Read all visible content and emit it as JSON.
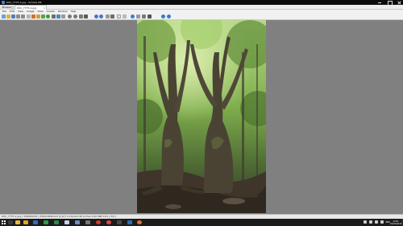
{
  "window": {
    "title": "DSC_7775-1.jpg - XnView MP",
    "controls": {
      "minimize": "minimize-icon",
      "maximize": "maximize-icon",
      "close": "close-icon"
    }
  },
  "tabs": [
    {
      "label": "Browser"
    },
    {
      "label": "DSC_7775-1.jpg",
      "close": "x"
    }
  ],
  "menu": [
    "File",
    "Edit",
    "View",
    "Image",
    "Tools",
    "Create",
    "Window",
    "Help"
  ],
  "toolbar": {
    "icons": [
      "browser-icon",
      "open-icon",
      "save-icon",
      "prev-icon",
      "next-icon",
      "print-icon",
      "settings-icon",
      "edit-icon",
      "grid-icon",
      "folder-icon",
      "copy-icon",
      "paste-icon",
      "zoom-in-icon",
      "zoom-out-icon",
      "fit-icon",
      "actual-size-icon",
      "fullscreen-icon",
      "rotate-left-icon",
      "rotate-right-icon",
      "crop-icon",
      "resize-icon",
      "adjust-icon",
      "filter-icon",
      "info-icon",
      "histogram-icon",
      "share-icon",
      "help-icon"
    ]
  },
  "statusbar": {
    "text": "DSC_7775-1.jpg [ 3368x5056 ]   2560x3840x24 (0.67)   13.61x20.48 inches   4.02 MiB   14% [ 3/5 ]"
  },
  "photo": {
    "description_icon": "forest-photo",
    "colors": {
      "canopy": "#8fbf5a",
      "trunk": "#4a4536",
      "ground": "#3b3328"
    }
  },
  "taskbar": {
    "apps": [
      "search-icon",
      "task-view-icon",
      "file-explorer-icon",
      "mail-icon",
      "calendar-icon",
      "store-icon",
      "word-icon",
      "excel-icon",
      "photos-icon",
      "settings-icon",
      "chrome-icon",
      "media-icon",
      "xnview-icon",
      "vivaldi-icon",
      "terminal-icon",
      "firefox-icon"
    ],
    "tray": [
      "chevron-up-icon",
      "network-icon",
      "volume-icon",
      "battery-icon"
    ],
    "lang": "ENG",
    "time": "13:51",
    "date": "22/07/2018"
  }
}
